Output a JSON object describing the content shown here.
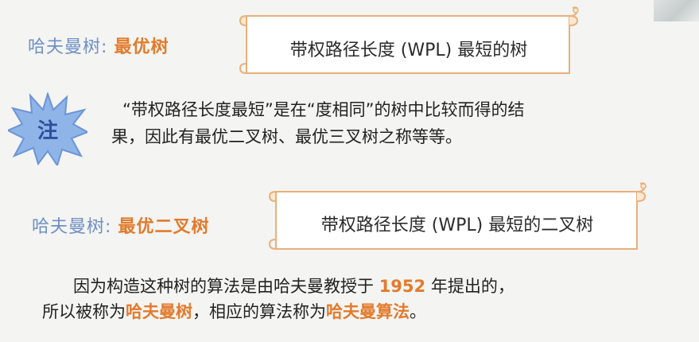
{
  "section1": {
    "name": "哈夫曼树",
    "colon": ":",
    "term": "最优树",
    "definition": "带权路径长度 (WPL) 最短的树"
  },
  "note": {
    "badge": "注",
    "line1": "“带权路径长度最短”是在“度相同”的树中比较而得的结",
    "line2": "果，因此有最优二叉树、最优三叉树之称等等。"
  },
  "section2": {
    "name": "哈夫曼树",
    "colon": ":",
    "term": "最优二叉树",
    "definition": "带权路径长度 (WPL) 最短的二叉树"
  },
  "bottom": {
    "l1_a": "因为构造这种树的算法是由哈夫曼教授于 ",
    "l1_year": "1952",
    "l1_b": " 年提出的，",
    "l2_a": "所以被称为",
    "l2_hl1": "哈夫曼树",
    "l2_b": "，相应的算法称为",
    "l2_hl2": "哈夫曼算法",
    "l2_c": "。"
  },
  "colors": {
    "accent_orange": "#e27b2c",
    "label_blue": "#6f8fc4",
    "scroll_border": "#e8b07a",
    "burst_blue": "#8fb4e8"
  }
}
